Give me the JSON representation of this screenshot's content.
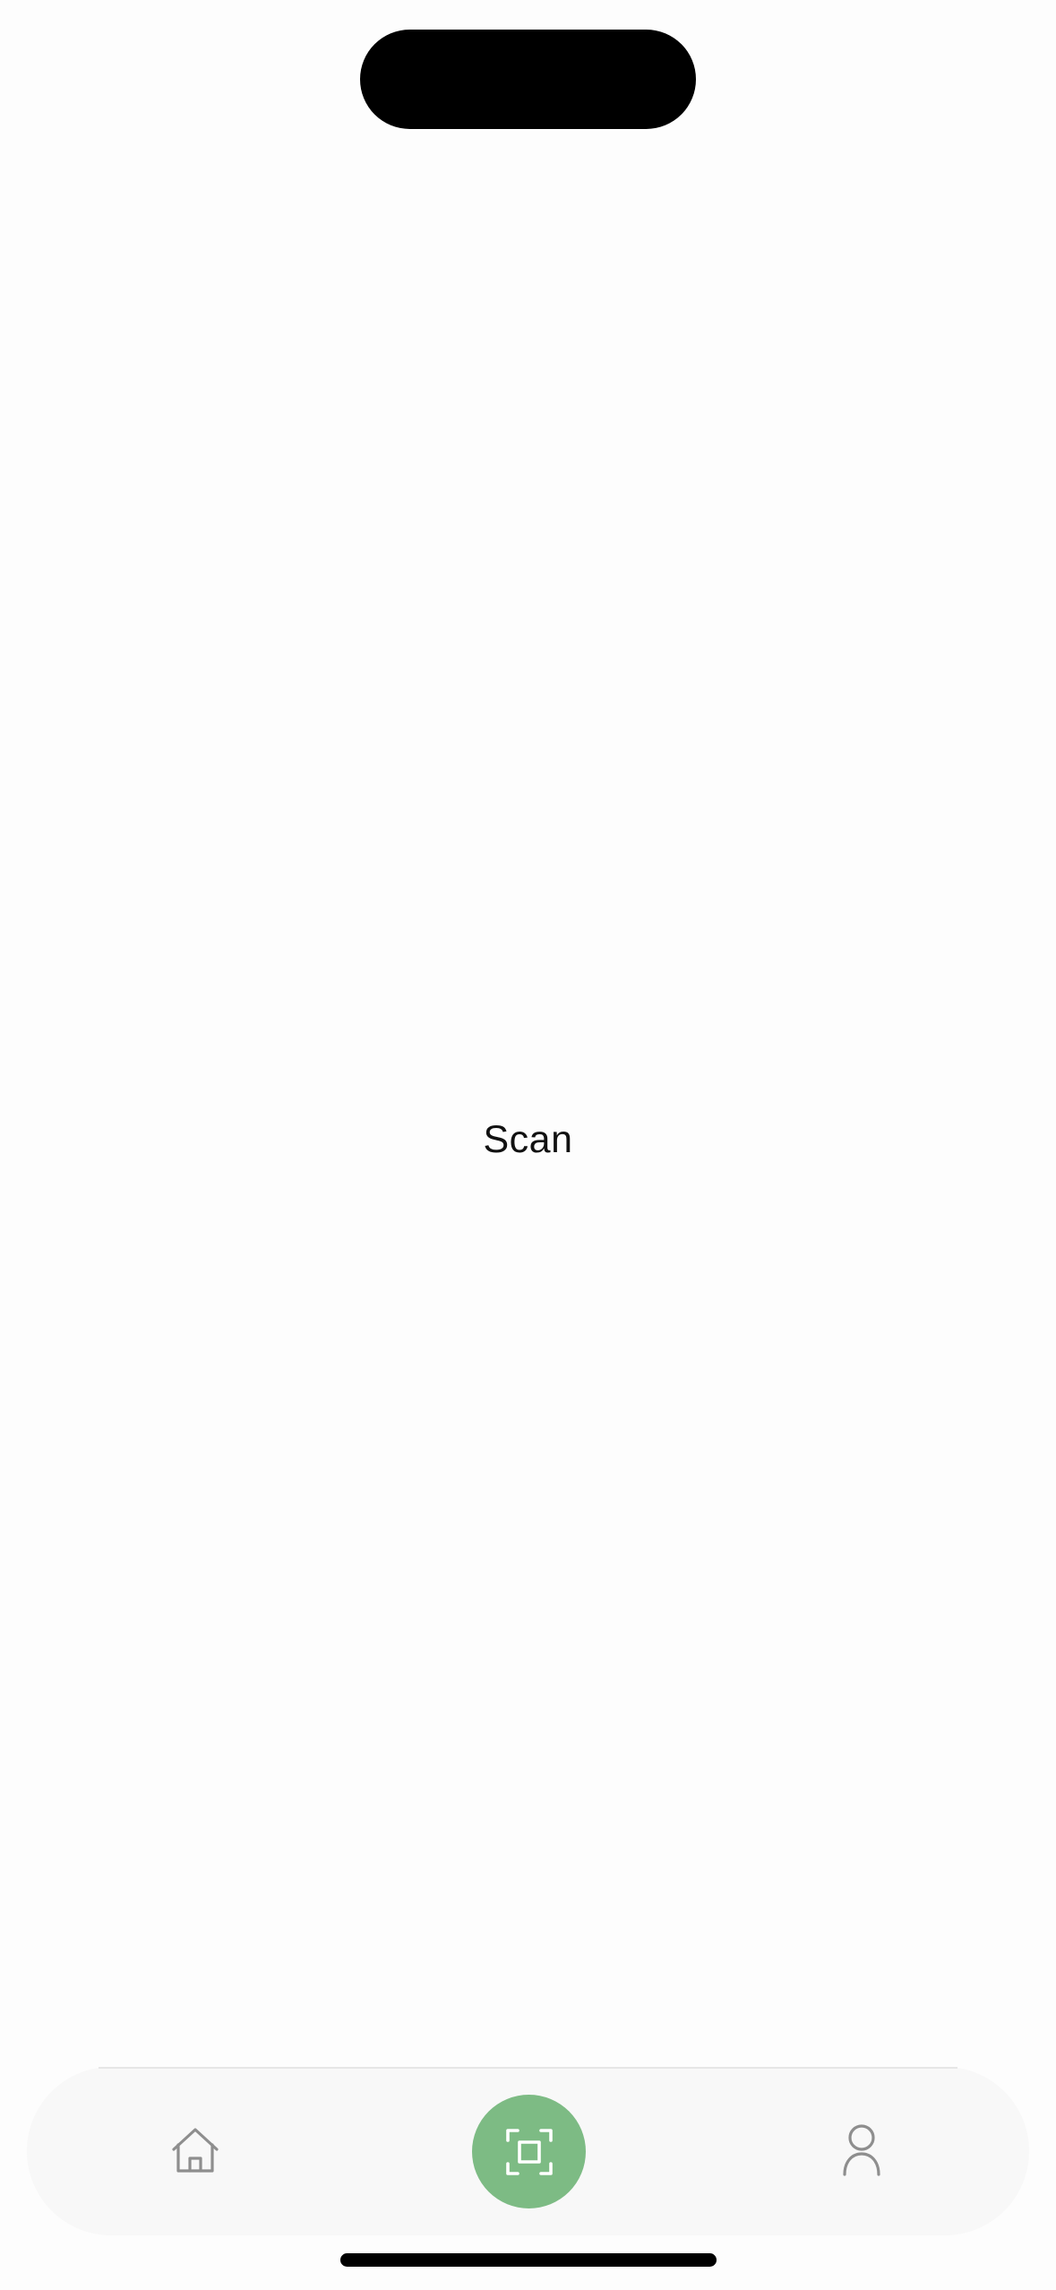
{
  "screen": {
    "title": "Scan"
  },
  "tab_bar": {
    "items": [
      {
        "id": "home",
        "icon": "home-icon",
        "active": false
      },
      {
        "id": "scan",
        "icon": "scan-icon",
        "active": true
      },
      {
        "id": "profile",
        "icon": "person-icon",
        "active": false
      }
    ],
    "colors": {
      "active_bg": "#7dbb84",
      "inactive_icon": "#8e8e8e",
      "active_icon": "#ffffff",
      "bar_bg": "#f8f8f8"
    }
  }
}
